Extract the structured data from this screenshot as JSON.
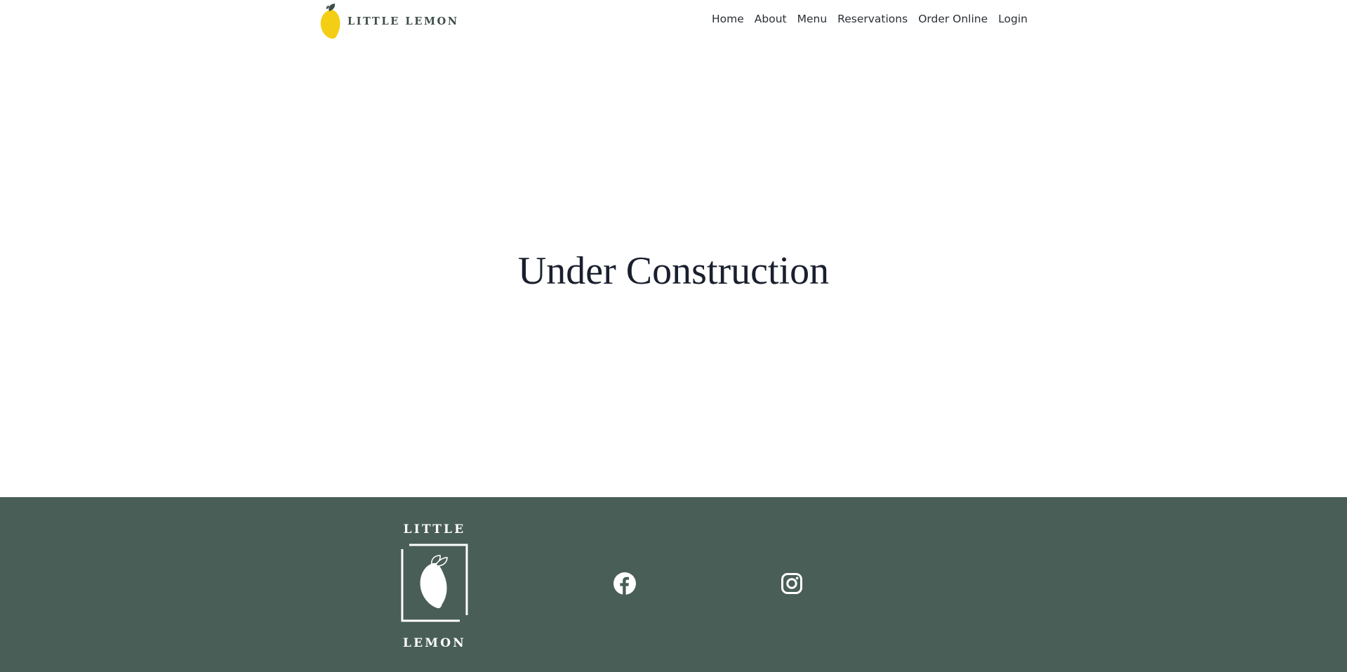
{
  "header": {
    "brand_text": "LITTLE LEMON",
    "nav": [
      {
        "label": "Home"
      },
      {
        "label": "About"
      },
      {
        "label": "Menu"
      },
      {
        "label": "Reservations"
      },
      {
        "label": "Order Online"
      },
      {
        "label": "Login"
      }
    ]
  },
  "main": {
    "title": "Under Construction"
  },
  "footer": {
    "logo_top": "LITTLE",
    "logo_bottom": "LEMON",
    "social": [
      {
        "icon": "facebook-icon"
      },
      {
        "icon": "instagram-icon"
      }
    ]
  },
  "colors": {
    "footer_bg": "#495e57",
    "lemon_yellow": "#f4ce14",
    "brand_green": "#3e4d47",
    "text_dark": "#1a1f2e"
  }
}
